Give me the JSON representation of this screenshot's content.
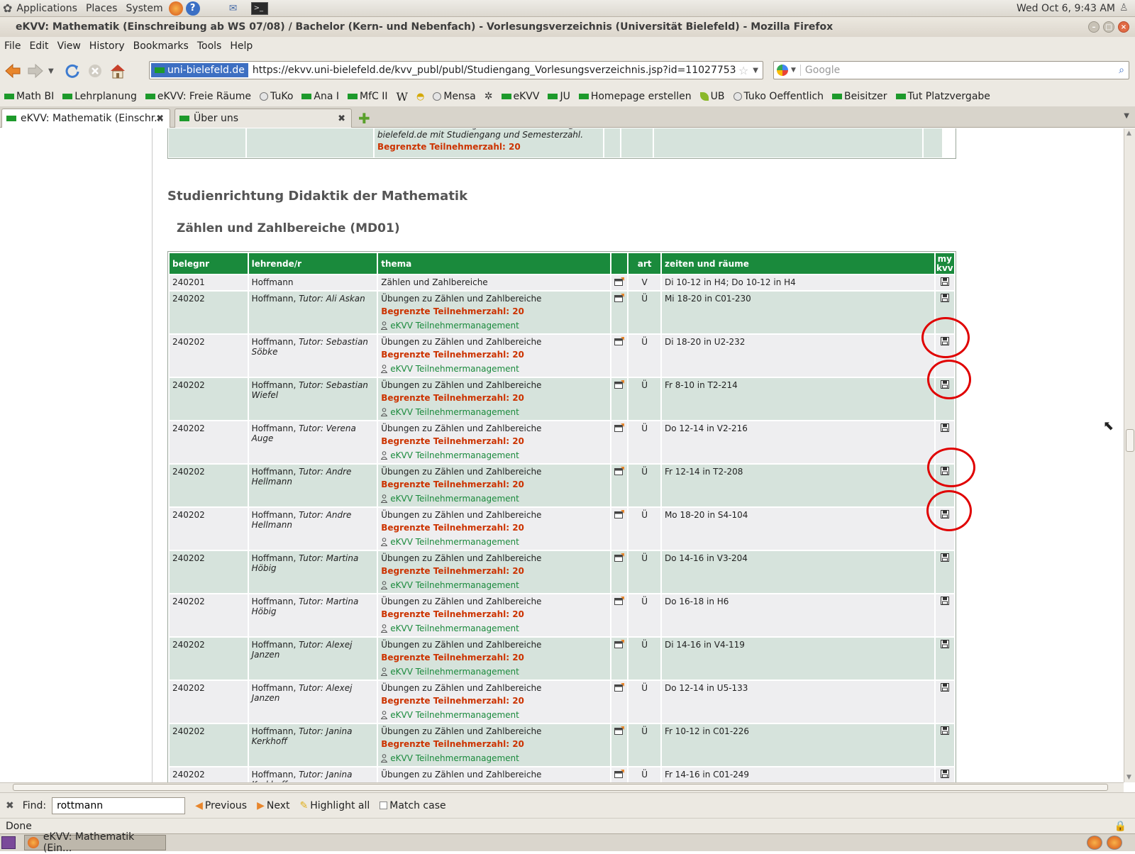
{
  "system_bar": {
    "menus": [
      "Applications",
      "Places",
      "System"
    ],
    "clock": "Wed Oct  6,  9:43 AM"
  },
  "window": {
    "title": "eKVV: Mathematik (Einschreibung ab WS 07/08) / Bachelor (Kern- und Nebenfach) - Vorlesungsverzeichnis (Universität Bielefeld) - Mozilla Firefox"
  },
  "menu": [
    "File",
    "Edit",
    "View",
    "History",
    "Bookmarks",
    "Tools",
    "Help"
  ],
  "navigation": {
    "site_identity": "uni-bielefeld.de",
    "url": "https://ekvv.uni-bielefeld.de/kvv_publ/publ/Studiengang_Vorlesungsverzeichnis.jsp?id=11027753",
    "search_placeholder": "Google"
  },
  "bookmarks": [
    "Math BI",
    "Lehrplanung",
    "eKVV: Freie Räume",
    "TuKo",
    "Ana I",
    "MfC II",
    "W",
    "",
    "Mensa",
    "",
    "eKVV",
    "JU",
    "Homepage erstellen",
    "UB",
    "Tuko Oeffentlich",
    "Beisitzer",
    "Tut Platzvergabe"
  ],
  "tabs": [
    {
      "label": "eKVV: Mathematik (Einschr..."
    },
    {
      "label": "Über uns"
    }
  ],
  "page": {
    "prev_row": {
      "text": "Persönliche Anmeldung an christiane.henkel@uni-bielefeld.de mit Studiengang und Semesterzahl.",
      "limit": "Begrenzte Teilnehmerzahl: 20"
    },
    "section_title": "Studienrichtung Didaktik der Mathematik",
    "subsection_title": "Zählen und Zahlbereiche (MD01)",
    "table": {
      "headers": {
        "belegnr": "belegnr",
        "lehrende": "lehrende/r",
        "thema": "thema",
        "art": "art",
        "zeiten": "zeiten und räume",
        "mykvv_1": "my",
        "mykvv_2": "kvv"
      },
      "rows": [
        {
          "belegnr": "240201",
          "lehrende": "Hoffmann",
          "tutor": "",
          "thema": "Zählen und Zahlbereiche",
          "limit": "",
          "link": "",
          "art": "V",
          "zeiten": "Di 10-12 in H4; Do 10-12 in H4"
        },
        {
          "belegnr": "240202",
          "lehrende": "Hoffmann, ",
          "tutor": "Tutor: Ali Askan",
          "thema": "Übungen zu Zählen und Zahlbereiche",
          "limit": "Begrenzte Teilnehmerzahl: 20",
          "link": "eKVV Teilnehmermanagement",
          "art": "Ü",
          "zeiten": "Mi 18-20 in C01-230"
        },
        {
          "belegnr": "240202",
          "lehrende": "Hoffmann, ",
          "tutor": "Tutor: Sebastian Söbke",
          "thema": "Übungen zu Zählen und Zahlbereiche",
          "limit": "Begrenzte Teilnehmerzahl: 20",
          "link": "eKVV Teilnehmermanagement",
          "art": "Ü",
          "zeiten": "Di 18-20 in U2-232"
        },
        {
          "belegnr": "240202",
          "lehrende": "Hoffmann, ",
          "tutor": "Tutor: Sebastian Wiefel",
          "thema": "Übungen zu Zählen und Zahlbereiche",
          "limit": "Begrenzte Teilnehmerzahl: 20",
          "link": "eKVV Teilnehmermanagement",
          "art": "Ü",
          "zeiten": "Fr 8-10 in T2-214"
        },
        {
          "belegnr": "240202",
          "lehrende": "Hoffmann, ",
          "tutor": "Tutor: Verena Auge",
          "thema": "Übungen zu Zählen und Zahlbereiche",
          "limit": "Begrenzte Teilnehmerzahl: 20",
          "link": "eKVV Teilnehmermanagement",
          "art": "Ü",
          "zeiten": "Do 12-14 in V2-216"
        },
        {
          "belegnr": "240202",
          "lehrende": "Hoffmann, ",
          "tutor": "Tutor: Andre Hellmann",
          "thema": "Übungen zu Zählen und Zahlbereiche",
          "limit": "Begrenzte Teilnehmerzahl: 20",
          "link": "eKVV Teilnehmermanagement",
          "art": "Ü",
          "zeiten": "Fr 12-14 in T2-208"
        },
        {
          "belegnr": "240202",
          "lehrende": "Hoffmann, ",
          "tutor": "Tutor: Andre Hellmann",
          "thema": "Übungen zu Zählen und Zahlbereiche",
          "limit": "Begrenzte Teilnehmerzahl: 20",
          "link": "eKVV Teilnehmermanagement",
          "art": "Ü",
          "zeiten": "Mo 18-20 in S4-104"
        },
        {
          "belegnr": "240202",
          "lehrende": "Hoffmann, ",
          "tutor": "Tutor: Martina Höbig",
          "thema": "Übungen zu Zählen und Zahlbereiche",
          "limit": "Begrenzte Teilnehmerzahl: 20",
          "link": "eKVV Teilnehmermanagement",
          "art": "Ü",
          "zeiten": "Do 14-16 in V3-204"
        },
        {
          "belegnr": "240202",
          "lehrende": "Hoffmann, ",
          "tutor": "Tutor: Martina Höbig",
          "thema": "Übungen zu Zählen und Zahlbereiche",
          "limit": "Begrenzte Teilnehmerzahl: 20",
          "link": "eKVV Teilnehmermanagement",
          "art": "Ü",
          "zeiten": "Do 16-18 in H6"
        },
        {
          "belegnr": "240202",
          "lehrende": "Hoffmann, ",
          "tutor": "Tutor: Alexej Janzen",
          "thema": "Übungen zu Zählen und Zahlbereiche",
          "limit": "Begrenzte Teilnehmerzahl: 20",
          "link": "eKVV Teilnehmermanagement",
          "art": "Ü",
          "zeiten": "Di 14-16 in V4-119"
        },
        {
          "belegnr": "240202",
          "lehrende": "Hoffmann, ",
          "tutor": "Tutor: Alexej Janzen",
          "thema": "Übungen zu Zählen und Zahlbereiche",
          "limit": "Begrenzte Teilnehmerzahl: 20",
          "link": "eKVV Teilnehmermanagement",
          "art": "Ü",
          "zeiten": "Do 12-14 in U5-133"
        },
        {
          "belegnr": "240202",
          "lehrende": "Hoffmann, ",
          "tutor": "Tutor: Janina Kerkhoff",
          "thema": "Übungen zu Zählen und Zahlbereiche",
          "limit": "Begrenzte Teilnehmerzahl: 20",
          "link": "eKVV Teilnehmermanagement",
          "art": "Ü",
          "zeiten": "Fr 10-12 in C01-226"
        },
        {
          "belegnr": "240202",
          "lehrende": "Hoffmann, ",
          "tutor": "Tutor: Janina Kerkhoff",
          "thema": "Übungen zu Zählen und Zahlbereiche",
          "limit": "",
          "link": "",
          "art": "Ü",
          "zeiten": "Fr 14-16 in C01-249"
        }
      ]
    }
  },
  "findbar": {
    "label": "Find:",
    "value": "rottmann",
    "previous": "Previous",
    "next": "Next",
    "highlight": "Highlight all",
    "match_case": "Match case"
  },
  "status": "Done",
  "taskbar": {
    "window_label": "eKVV: Mathematik (Ein..."
  },
  "colors": {
    "header_green": "#1a8a3c",
    "row_green": "#d6e3dc",
    "row_grey": "#eeeef0",
    "limit_red": "#cc3300",
    "annotation_red": "#e00000"
  }
}
